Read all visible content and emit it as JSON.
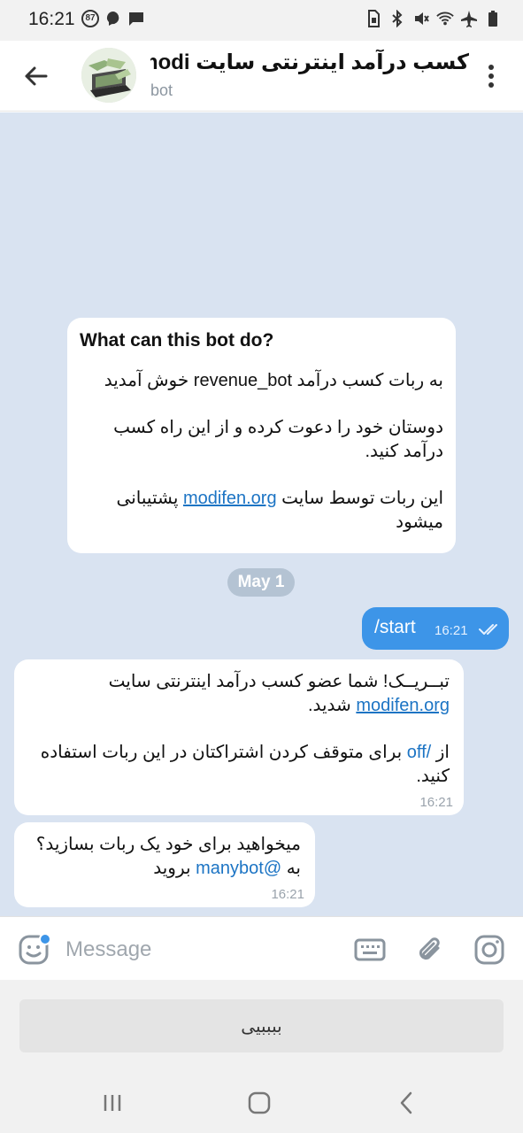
{
  "status": {
    "time": "16:21",
    "notification_count": "87",
    "left_icons": [
      "notification-count-icon",
      "messenger-icon",
      "chat-icon"
    ],
    "right_icons": [
      "sim-icon",
      "bluetooth-icon",
      "mute-icon",
      "wifi-icon",
      "airplane-icon",
      "battery-icon"
    ]
  },
  "header": {
    "title": "کسب درآمد اینترنتی سایت modi...",
    "subtitle": "bot",
    "back_icon": "arrow-left-icon",
    "menu_icon": "more-vertical-icon"
  },
  "bot_info": {
    "heading": "What can this bot do?",
    "line1_pre": "به ربات کسب درآمد ",
    "line1_bot": "revenue_bot",
    "line1_post": " خوش آمدید",
    "line2": "دوستان خود را دعوت کرده و از این راه کسب درآمد کنید.",
    "line3_pre": "این ربات توسط سایت ",
    "line3_link": "modifen.org",
    "line3_post": " پشتیبانی میشود"
  },
  "date_divider": "May 1",
  "outgoing": {
    "text": "/start",
    "time": "16:21",
    "status": "read"
  },
  "message1": {
    "line1": "تبــریــک! شما عضو کسب درآمد اینترنتی سایت ",
    "link": "modifen.org",
    "line1_post": " شدید.",
    "line2_pre": "از ",
    "command": "/off",
    "line2_post": " برای متوقف کردن اشتراکتان در این ربات استفاده کنید.",
    "time": "16:21"
  },
  "message2": {
    "line1": "میخواهید برای خود یک ربات بسازید؟",
    "line2_pre": "به ",
    "mention": "@manybot",
    "line2_post": " بروید",
    "time": "16:21"
  },
  "input": {
    "placeholder": "Message",
    "icons": [
      "emoji-icon",
      "keyboard-icon",
      "attach-icon",
      "camera-icon"
    ]
  },
  "keyboard": {
    "button_label": "ببببیی"
  },
  "nav": {
    "icons": [
      "recents-icon",
      "home-icon",
      "back-icon"
    ]
  },
  "colors": {
    "chat_bg": "#d9e3f1",
    "outgoing_bubble": "#3d95e8",
    "link": "#1c74c4"
  }
}
